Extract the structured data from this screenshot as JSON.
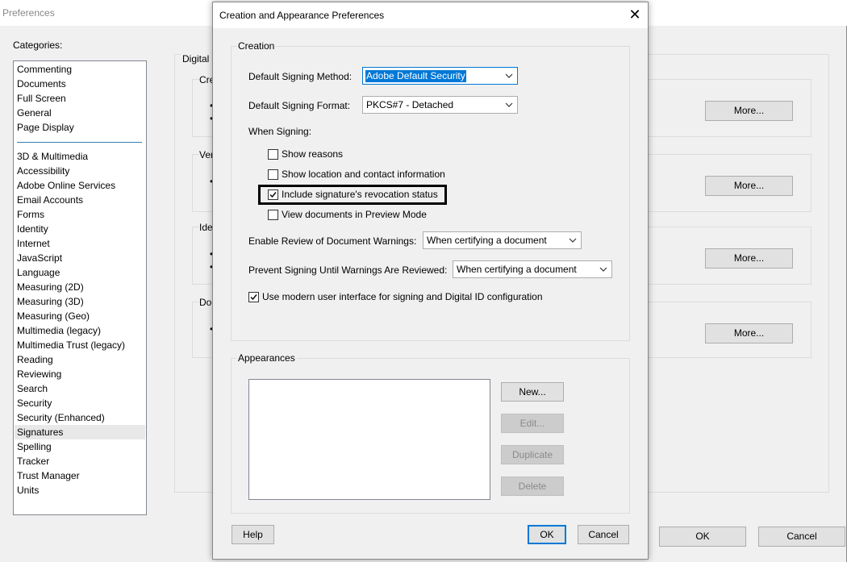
{
  "background_window": {
    "title": "Preferences",
    "categories_label": "Categories:",
    "categories_top": [
      "Commenting",
      "Documents",
      "Full Screen",
      "General",
      "Page Display"
    ],
    "categories_bottom": [
      "3D & Multimedia",
      "Accessibility",
      "Adobe Online Services",
      "Email Accounts",
      "Forms",
      "Identity",
      "Internet",
      "JavaScript",
      "Language",
      "Measuring (2D)",
      "Measuring (3D)",
      "Measuring (Geo)",
      "Multimedia (legacy)",
      "Multimedia Trust (legacy)",
      "Reading",
      "Reviewing",
      "Search",
      "Security",
      "Security (Enhanced)",
      "Signatures",
      "Spelling",
      "Tracker",
      "Trust Manager",
      "Units"
    ],
    "selected_category": "Signatures",
    "panel_label": "Digital S",
    "group_labels": [
      "Cre",
      "Ver",
      "Ide",
      "Doc"
    ],
    "more_label": "More...",
    "ok_label": "OK",
    "cancel_label": "Cancel"
  },
  "dialog": {
    "title": "Creation and Appearance Preferences",
    "close_glyph": "✕",
    "creation": {
      "group_label": "Creation",
      "signing_method_label": "Default Signing Method:",
      "signing_method_value": "Adobe Default Security",
      "signing_format_label": "Default Signing Format:",
      "signing_format_value": "PKCS#7 - Detached",
      "when_signing_label": "When Signing:",
      "checkboxes": [
        {
          "label": "Show reasons",
          "checked": false
        },
        {
          "label": "Show location and contact information",
          "checked": false
        },
        {
          "label": "Include signature's revocation status",
          "checked": true
        },
        {
          "label": "View documents in Preview Mode",
          "checked": false
        }
      ],
      "review_warnings_label": "Enable Review of Document Warnings:",
      "review_warnings_value": "When certifying a document",
      "prevent_signing_label": "Prevent Signing Until Warnings Are Reviewed:",
      "prevent_signing_value": "When certifying a document",
      "modern_ui_label": "Use modern user interface for signing and Digital ID configuration",
      "modern_ui_checked": true
    },
    "appearances": {
      "group_label": "Appearances",
      "new_label": "New...",
      "edit_label": "Edit...",
      "duplicate_label": "Duplicate",
      "delete_label": "Delete"
    },
    "help_label": "Help",
    "ok_label": "OK",
    "cancel_label": "Cancel"
  },
  "colors": {
    "accent": "#0078d7",
    "selection_separator": "#3c7fb1"
  }
}
